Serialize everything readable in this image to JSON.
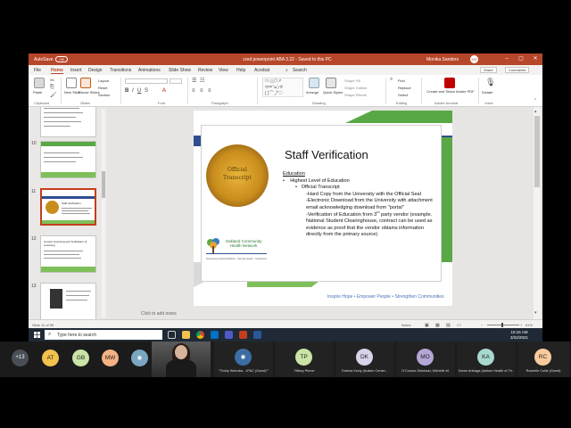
{
  "window": {
    "autosave_label": "AutoSave",
    "autosave_state": "Off",
    "document_title": "cred powerpoint ABA 3.22 - Saved to this PC",
    "user_name": "Monika Sanders",
    "user_initials": "MS"
  },
  "menu": {
    "tabs": [
      "File",
      "Home",
      "Insert",
      "Design",
      "Transitions",
      "Animations",
      "Slide Show",
      "Review",
      "View",
      "Help",
      "Acrobat"
    ],
    "search_placeholder": "Search",
    "share_label": "Share",
    "comments_label": "Comments"
  },
  "ribbon": {
    "paste_label": "Paste",
    "new_slide_label": "New Slide",
    "reuse_slides_label": "Reuse Slides",
    "layout_label": "Layout",
    "reset_label": "Reset",
    "section_label": "Section",
    "arrange_label": "Arrange",
    "quick_styles_label": "Quick Styles",
    "shape_fill_label": "Shape Fill",
    "shape_outline_label": "Shape Outline",
    "shape_effects_label": "Shape Effects",
    "find_label": "Find",
    "replace_label": "Replace",
    "select_label": "Select",
    "create_share_pdf_label": "Create and Share Adobe PDF",
    "dictate_label": "Dictate",
    "groups": [
      "Clipboard",
      "Slides",
      "Font",
      "Paragraph",
      "Drawing",
      "Editing",
      "Adobe Acrobat",
      "Voice"
    ]
  },
  "thumbnails": [
    {
      "number": "",
      "title": ""
    },
    {
      "number": "10",
      "title": ""
    },
    {
      "number": "11",
      "title": "Staff Verification"
    },
    {
      "number": "12",
      "title": "Current Licensing and Verification of Licensing"
    },
    {
      "number": "13",
      "title": ""
    }
  ],
  "slide": {
    "title": "Staff Verification",
    "seal_text_line1": "Official",
    "seal_text_line2": "Transcript",
    "heading": "Education",
    "bullet1": "Highest Level of Education",
    "bullet2": "Official Transcript",
    "line1": "-Hard Copy from the University with the Official Seal",
    "line2": "-Electronic Download from the University with attachment email acknowledging download from \"portal\"",
    "line3_prefix": "-Verification of Education from 3",
    "line3_sup": "rd",
    "line3_suffix": " party vendor (example.  National Student Clearinghouse, contract can be used as evidence as proof that the vendor obtains information directly from the primary source)",
    "logo_name": "Oakland Community Health Network",
    "logo_sub": "Developmental Disabilities · Mental Health · Substance Use Disorder",
    "tagline": "Inspire Hope • Empower People • Strengthen Communities"
  },
  "notes_placeholder": "Click to add notes",
  "status": {
    "slide_indicator": "Slide 11 of 55",
    "notes_label": "Notes",
    "zoom": "61%"
  },
  "taskbar": {
    "search_placeholder": "Type here to search",
    "time": "10:15 AM",
    "date": "3/22/2021"
  },
  "participants": {
    "more_count": "+13",
    "list": [
      {
        "initials": "AT",
        "color": "#f2c14e",
        "name": ""
      },
      {
        "initials": "GB",
        "color": "#c9e4a6",
        "name": ""
      },
      {
        "initials": "MW",
        "color": "#f4b183",
        "name": ""
      },
      {
        "initials": "",
        "color": "#7aa6c2",
        "name": ""
      },
      {
        "initials": "",
        "color": "#3b6ea5",
        "name": "\"\"Emily Wotruba - JPAC (Guest)\"\""
      },
      {
        "initials": "TP",
        "color": "#c9e4a6",
        "name": "Tiffany Pierce"
      },
      {
        "initials": "DK",
        "color": "#d9d2e9",
        "name": "Dolena Kezly (Autism Center..."
      },
      {
        "initials": "MO",
        "color": "#b4a7d6",
        "name": "O'Connor-Siekloski, Michelle M."
      },
      {
        "initials": "KA",
        "color": "#a7d8d0",
        "name": "Karen Arteaga (Autism Health of Th..."
      },
      {
        "initials": "RC",
        "color": "#f9cb9c",
        "name": "Rockelle Collie (Guest)"
      }
    ]
  }
}
